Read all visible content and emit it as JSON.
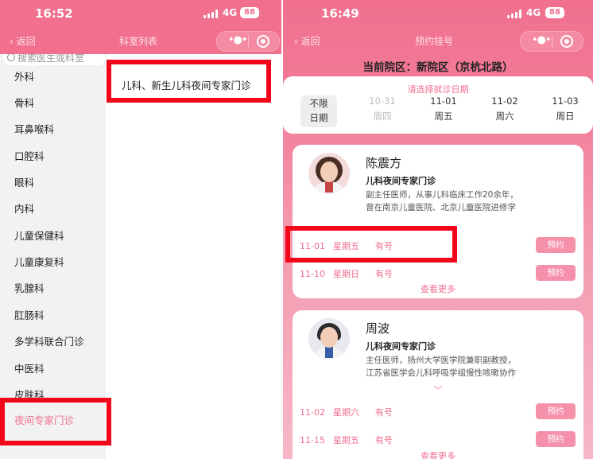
{
  "left": {
    "status": {
      "time": "16:52",
      "network": "4G",
      "battery": "88"
    },
    "nav": {
      "back": "返回",
      "title": "科室列表"
    },
    "search": {
      "placeholder": "搜索医生或科室"
    },
    "departments": [
      "外科",
      "骨科",
      "耳鼻喉科",
      "口腔科",
      "眼科",
      "内科",
      "儿童保健科",
      "儿童康复科",
      "乳腺科",
      "肛肠科",
      "多学科联合门诊",
      "中医科",
      "皮肤科",
      "夜间专家门诊"
    ],
    "active_department": "夜间专家门诊",
    "content_entry": "儿科、新生儿科夜间专家门诊"
  },
  "right": {
    "status": {
      "time": "16:49",
      "network": "4G",
      "battery": "88"
    },
    "nav": {
      "back": "返回",
      "title": "预约挂号"
    },
    "campus": "当前院区：新院区（京杭北路）",
    "date_hint": "请选择就诊日期",
    "dates": [
      {
        "date": "不限",
        "week": "日期",
        "state": "selected"
      },
      {
        "date": "10-31",
        "week": "周四",
        "state": "past"
      },
      {
        "date": "11-01",
        "week": "周五",
        "state": "available"
      },
      {
        "date": "11-02",
        "week": "周六",
        "state": "available"
      },
      {
        "date": "11-03",
        "week": "周日",
        "state": "available"
      }
    ],
    "doctors": [
      {
        "name": "陈震方",
        "dept": "儿科夜间专家门诊",
        "intro1": "副主任医师，从事儿科临床工作20余年，",
        "intro2": "曾在南京儿童医院、北京儿童医院进修学",
        "slots": [
          {
            "date": "11-01",
            "weekday": "星期五",
            "status": "有号",
            "button": "预约"
          },
          {
            "date": "11-10",
            "weekday": "星期日",
            "status": "有号",
            "button": "预约"
          }
        ],
        "more": "查看更多"
      },
      {
        "name": "周波",
        "dept": "儿科夜间专家门诊",
        "intro1": "主任医师，扬州大学医学院兼职副教授，",
        "intro2": "江苏省医学会儿科呼吸学组慢性咳嗽协作",
        "expand": "﹀",
        "slots": [
          {
            "date": "11-02",
            "weekday": "星期六",
            "status": "有号",
            "button": "预约"
          },
          {
            "date": "11-15",
            "weekday": "星期五",
            "status": "有号",
            "button": "预约"
          }
        ],
        "more": "查看更多"
      }
    ]
  },
  "colors": {
    "brand_pink": "#f0708e",
    "button_pink": "#f591aa",
    "annotation_red": "#f2071a",
    "sidebar_gray": "#f2f2f2"
  },
  "icons": {
    "signal": "signal-bars-icon",
    "capsule_menu": "more-dots-icon",
    "capsule_close": "record-circle-icon",
    "back": "chevron-left-icon",
    "search": "search-icon",
    "expand": "chevron-down-icon"
  }
}
